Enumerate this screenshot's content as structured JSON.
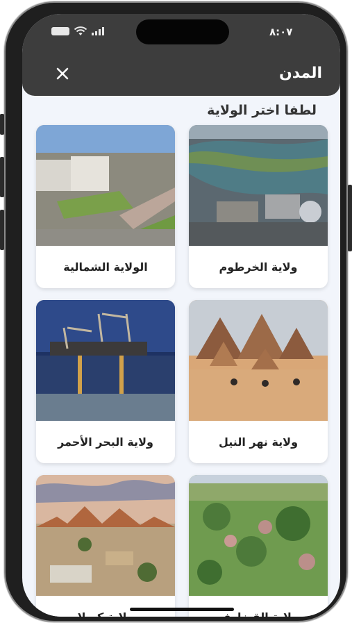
{
  "status_bar": {
    "time": "٨:٠٧",
    "icons": [
      "signal-icon",
      "wifi-icon",
      "battery-icon"
    ]
  },
  "header": {
    "title": "المدن",
    "close_icon": "close-icon"
  },
  "subtitle": "لطفا اختر الولاية",
  "states": [
    {
      "name": "ولاية الخرطوم",
      "image": "aerial city along river"
    },
    {
      "name": "الولاية الشمالية",
      "image": "aerial complex with buildings and roads"
    },
    {
      "name": "ولاية نهر النيل",
      "image": "pyramids with camels in desert"
    },
    {
      "name": "ولاية البحر الأحمر",
      "image": "port cranes at dusk"
    },
    {
      "name": "ولاية القضارف",
      "image": "aerial village with green trees"
    },
    {
      "name": "ولاية كسلا",
      "image": "town with mountains at sunset"
    }
  ],
  "colors": {
    "header_bg": "#3d3d3d",
    "screen_bg": "#f2f5fb",
    "card_bg": "#ffffff"
  }
}
